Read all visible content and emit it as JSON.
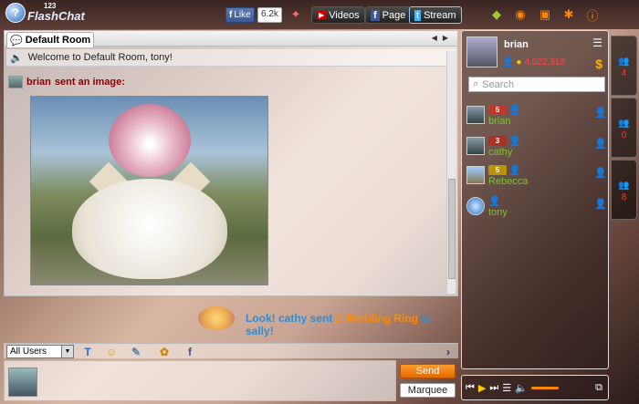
{
  "header": {
    "logo_num": "123",
    "logo_text": "FlashChat",
    "fb_like": "Like",
    "fb_count": "6.2k",
    "videos": "Videos",
    "page": "Page",
    "stream": "Stream"
  },
  "room": {
    "tab_label": "Default Room",
    "welcome": "Welcome to Default Room, tony!",
    "sender": "brian",
    "sent_action": "sent an image:"
  },
  "gift": {
    "prefix": "Look! cathy sent ",
    "item": "1 Wedding Ring",
    "suffix": " to sally!"
  },
  "toolbar": {
    "recipient": "All Users"
  },
  "actions": {
    "send": "Send",
    "marquee": "Marquee"
  },
  "me": {
    "name": "brian",
    "credits": "4,022,319"
  },
  "search": {
    "placeholder": "Search"
  },
  "users": [
    {
      "name": "brian",
      "level": "5",
      "lvl_color": "#c0392b"
    },
    {
      "name": "cathy",
      "level": "3",
      "lvl_color": "#a93226"
    },
    {
      "name": "Rebecca",
      "level": "5",
      "lvl_color": "#b7950b"
    },
    {
      "name": "tony",
      "level": "",
      "lvl_color": ""
    }
  ],
  "tabs": [
    {
      "count": "4"
    },
    {
      "count": "0"
    },
    {
      "count": "8"
    }
  ]
}
